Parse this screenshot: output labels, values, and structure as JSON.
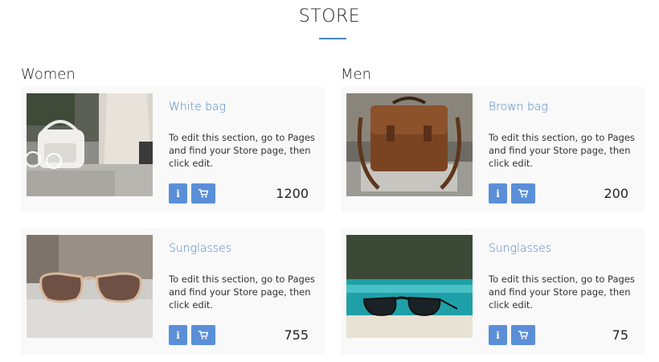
{
  "store": {
    "title": "STORE",
    "accent_color": "#4a86c5",
    "button_color": "#5a8fd8"
  },
  "categories": {
    "women": "Women",
    "men": "Men"
  },
  "products": [
    {
      "name": "White bag",
      "description": "To edit this section, go to Pages and find your Store page, then click edit.",
      "price": "1200",
      "image": "white-bag-photo",
      "info_icon": "info-icon",
      "cart_icon": "cart-icon"
    },
    {
      "name": "Brown bag",
      "description": "To edit this section, go to Pages and find your Store page, then click edit.",
      "price": "200",
      "image": "brown-bag-photo",
      "info_icon": "info-icon",
      "cart_icon": "cart-icon"
    },
    {
      "name": "Sunglasses",
      "description": "To edit this section, go to Pages and find your Store page, then click edit.",
      "price": "755",
      "image": "cat-eye-sunglasses-photo",
      "info_icon": "info-icon",
      "cart_icon": "cart-icon"
    },
    {
      "name": "Sunglasses",
      "description": "To edit this section, go to Pages and find your Store page, then click edit.",
      "price": "75",
      "image": "wayfarer-sunglasses-photo",
      "info_icon": "info-icon",
      "cart_icon": "cart-icon"
    }
  ],
  "info_symbol": "i"
}
